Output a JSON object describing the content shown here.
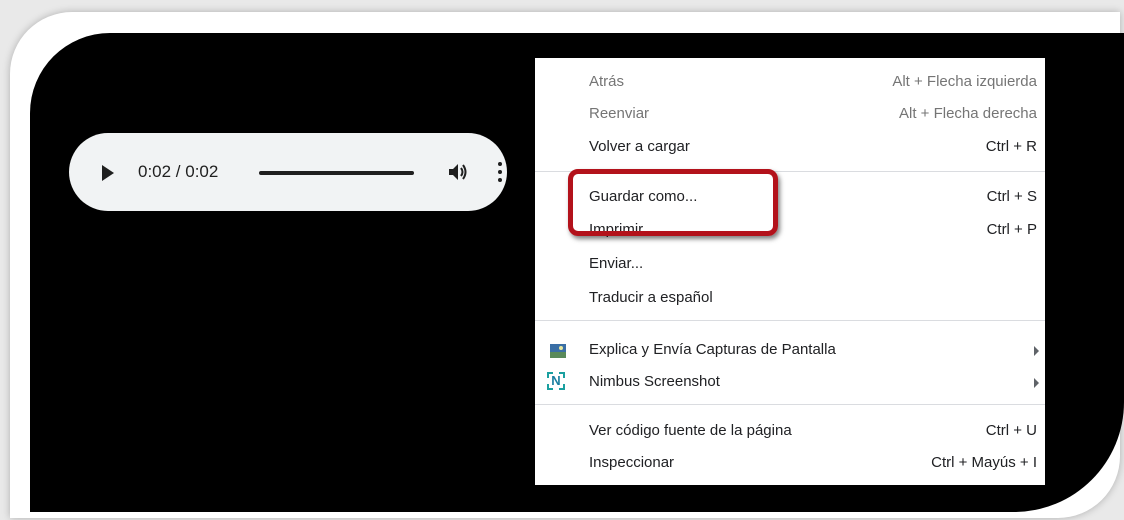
{
  "player": {
    "time": "0:02 / 0:02",
    "progress_fraction": 1.0,
    "icons": [
      "play-icon",
      "volume-icon",
      "more-vert-icon"
    ]
  },
  "menu": {
    "items": [
      {
        "label": "Atrás",
        "shortcut": "Alt + Flecha izquierda",
        "disabled": true
      },
      {
        "label": "Reenviar",
        "shortcut": "Alt + Flecha derecha",
        "disabled": true
      },
      {
        "label": "Volver a cargar",
        "shortcut": "Ctrl + R",
        "disabled": false
      },
      {
        "label": "Guardar como...",
        "shortcut": "Ctrl + S",
        "disabled": false
      },
      {
        "label": "Imprimir...",
        "shortcut": "Ctrl + P",
        "disabled": false
      },
      {
        "label": "Enviar...",
        "shortcut": "",
        "disabled": false
      },
      {
        "label": "Traducir a español",
        "shortcut": "",
        "disabled": false
      },
      {
        "label": "Explica y Envía Capturas de Pantalla",
        "shortcut": "",
        "submenu": true,
        "icon": "screenshot-extension-icon"
      },
      {
        "label": "Nimbus Screenshot",
        "shortcut": "",
        "submenu": true,
        "icon": "nimbus-icon"
      },
      {
        "label": "Ver código fuente de la página",
        "shortcut": "Ctrl + U",
        "disabled": false
      },
      {
        "label": "Inspeccionar",
        "shortcut": "Ctrl + Mayús + I",
        "disabled": false
      }
    ],
    "nimbus_icon_letter": "N"
  },
  "colors": {
    "highlight": "#b3121b",
    "player_bg": "#f1f3f4",
    "screen_bg": "#000000"
  }
}
